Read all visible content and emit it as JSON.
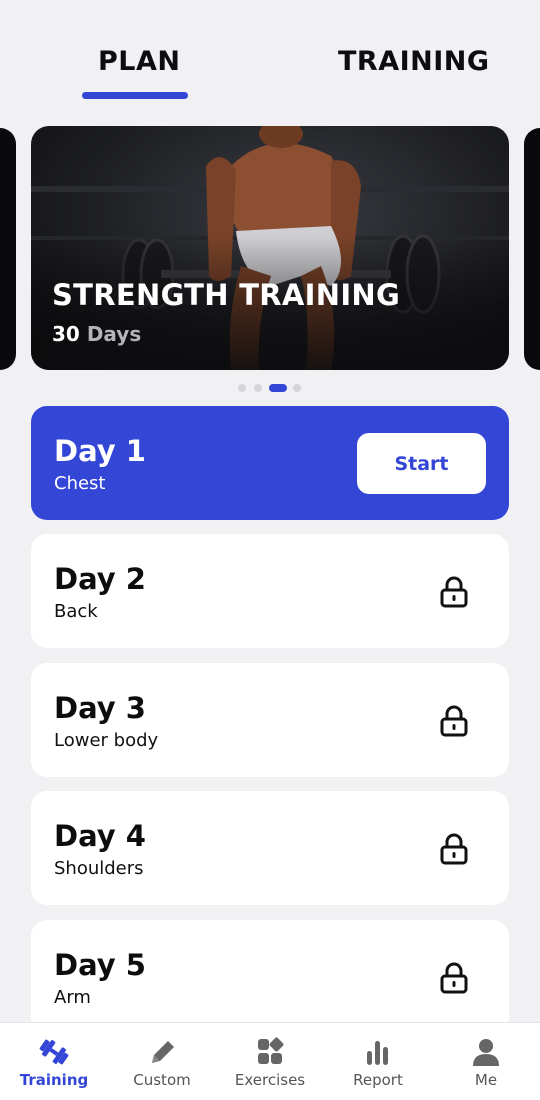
{
  "top_tabs": {
    "plan": "PLAN",
    "training": "TRAINING",
    "active": "plan"
  },
  "carousel": {
    "title": "STRENGTH TRAINING",
    "days_number": "30",
    "days_unit": "Days",
    "page_count": 4,
    "active_page": 3
  },
  "days": [
    {
      "title": "Day 1",
      "subtitle": "Chest",
      "status": "active",
      "action": "Start"
    },
    {
      "title": "Day 2",
      "subtitle": "Back",
      "status": "locked"
    },
    {
      "title": "Day 3",
      "subtitle": "Lower body",
      "status": "locked"
    },
    {
      "title": "Day 4",
      "subtitle": "Shoulders",
      "status": "locked"
    },
    {
      "title": "Day 5",
      "subtitle": "Arm",
      "status": "locked"
    }
  ],
  "bottom_nav": {
    "items": [
      {
        "label": "Training",
        "icon": "dumbbell-icon",
        "active": true
      },
      {
        "label": "Custom",
        "icon": "pencil-icon",
        "active": false
      },
      {
        "label": "Exercises",
        "icon": "grid-icon",
        "active": false
      },
      {
        "label": "Report",
        "icon": "bar-chart-icon",
        "active": false
      },
      {
        "label": "Me",
        "icon": "person-icon",
        "active": false
      }
    ]
  },
  "colors": {
    "accent": "#3346d6",
    "background": "#f1f1f4",
    "card": "#ffffff"
  }
}
